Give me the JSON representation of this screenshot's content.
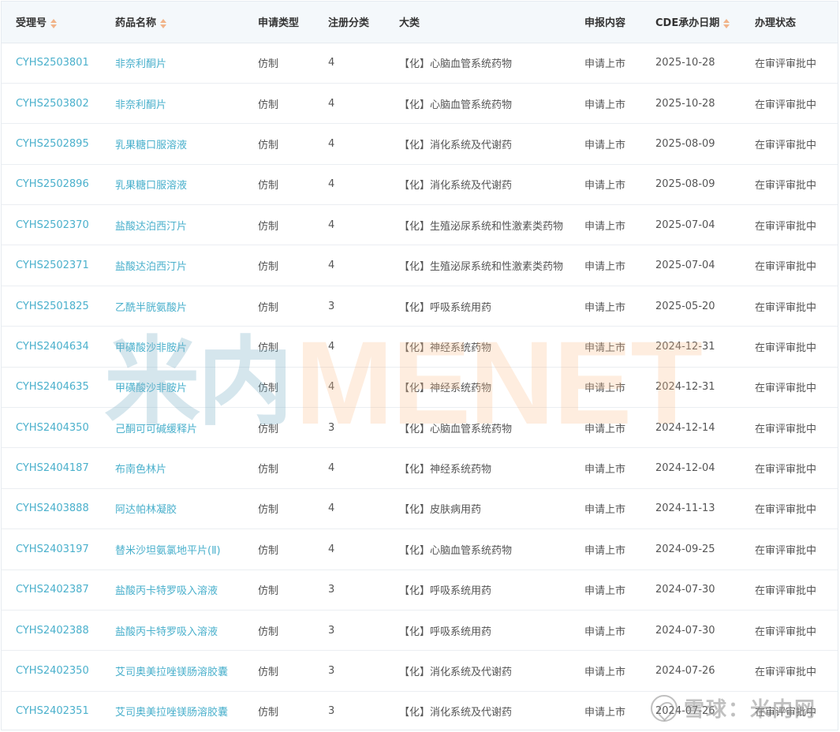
{
  "columns": [
    "受理号",
    "药品名称",
    "申请类型",
    "注册分类",
    "大类",
    "申报内容",
    "CDE承办日期",
    "办理状态"
  ],
  "sortable_columns": [
    "受理号",
    "药品名称",
    "CDE承办日期"
  ],
  "rows": [
    [
      "CYHS2503801",
      "非奈利酮片",
      "仿制",
      "4",
      "【化】心脑血管系统药物",
      "申请上市",
      "2025-10-28",
      "在审评审批中"
    ],
    [
      "CYHS2503802",
      "非奈利酮片",
      "仿制",
      "4",
      "【化】心脑血管系统药物",
      "申请上市",
      "2025-10-28",
      "在审评审批中"
    ],
    [
      "CYHS2502895",
      "乳果糖口服溶液",
      "仿制",
      "4",
      "【化】消化系统及代谢药",
      "申请上市",
      "2025-08-09",
      "在审评审批中"
    ],
    [
      "CYHS2502896",
      "乳果糖口服溶液",
      "仿制",
      "4",
      "【化】消化系统及代谢药",
      "申请上市",
      "2025-08-09",
      "在审评审批中"
    ],
    [
      "CYHS2502370",
      "盐酸达泊西汀片",
      "仿制",
      "4",
      "【化】生殖泌尿系统和性激素类药物",
      "申请上市",
      "2025-07-04",
      "在审评审批中"
    ],
    [
      "CYHS2502371",
      "盐酸达泊西汀片",
      "仿制",
      "4",
      "【化】生殖泌尿系统和性激素类药物",
      "申请上市",
      "2025-07-04",
      "在审评审批中"
    ],
    [
      "CYHS2501825",
      "乙酰半胱氨酸片",
      "仿制",
      "3",
      "【化】呼吸系统用药",
      "申请上市",
      "2025-05-20",
      "在审评审批中"
    ],
    [
      "CYHS2404634",
      "甲磺酸沙非胺片",
      "仿制",
      "4",
      "【化】神经系统药物",
      "申请上市",
      "2024-12-31",
      "在审评审批中"
    ],
    [
      "CYHS2404635",
      "甲磺酸沙非胺片",
      "仿制",
      "4",
      "【化】神经系统药物",
      "申请上市",
      "2024-12-31",
      "在审评审批中"
    ],
    [
      "CYHS2404350",
      "己酮可可碱缓释片",
      "仿制",
      "3",
      "【化】心脑血管系统药物",
      "申请上市",
      "2024-12-14",
      "在审评审批中"
    ],
    [
      "CYHS2404187",
      "布南色林片",
      "仿制",
      "4",
      "【化】神经系统药物",
      "申请上市",
      "2024-12-04",
      "在审评审批中"
    ],
    [
      "CYHS2403888",
      "阿达帕林凝胶",
      "仿制",
      "4",
      "【化】皮肤病用药",
      "申请上市",
      "2024-11-13",
      "在审评审批中"
    ],
    [
      "CYHS2403197",
      "替米沙坦氨氯地平片(Ⅱ)",
      "仿制",
      "4",
      "【化】心脑血管系统药物",
      "申请上市",
      "2024-09-25",
      "在审评审批中"
    ],
    [
      "CYHS2402387",
      "盐酸丙卡特罗吸入溶液",
      "仿制",
      "3",
      "【化】呼吸系统用药",
      "申请上市",
      "2024-07-30",
      "在审评审批中"
    ],
    [
      "CYHS2402388",
      "盐酸丙卡特罗吸入溶液",
      "仿制",
      "3",
      "【化】呼吸系统用药",
      "申请上市",
      "2024-07-30",
      "在审评审批中"
    ],
    [
      "CYHS2402350",
      "艾司奥美拉唑镁肠溶胶囊",
      "仿制",
      "3",
      "【化】消化系统及代谢药",
      "申请上市",
      "2024-07-26",
      "在审评审批中"
    ],
    [
      "CYHS2402351",
      "艾司奥美拉唑镁肠溶胶囊",
      "仿制",
      "3",
      "【化】消化系统及代谢药",
      "申请上市",
      "2024-07-26",
      "在审评审批中"
    ]
  ],
  "watermark": {
    "cn": "米内",
    "en": "MENET"
  },
  "corner_watermark": {
    "text": "雪球：米内网"
  },
  "colors": {
    "link": "#4ab0cc",
    "header_bg": "#f4f8fb",
    "sort_icon": "#f1b48a"
  }
}
